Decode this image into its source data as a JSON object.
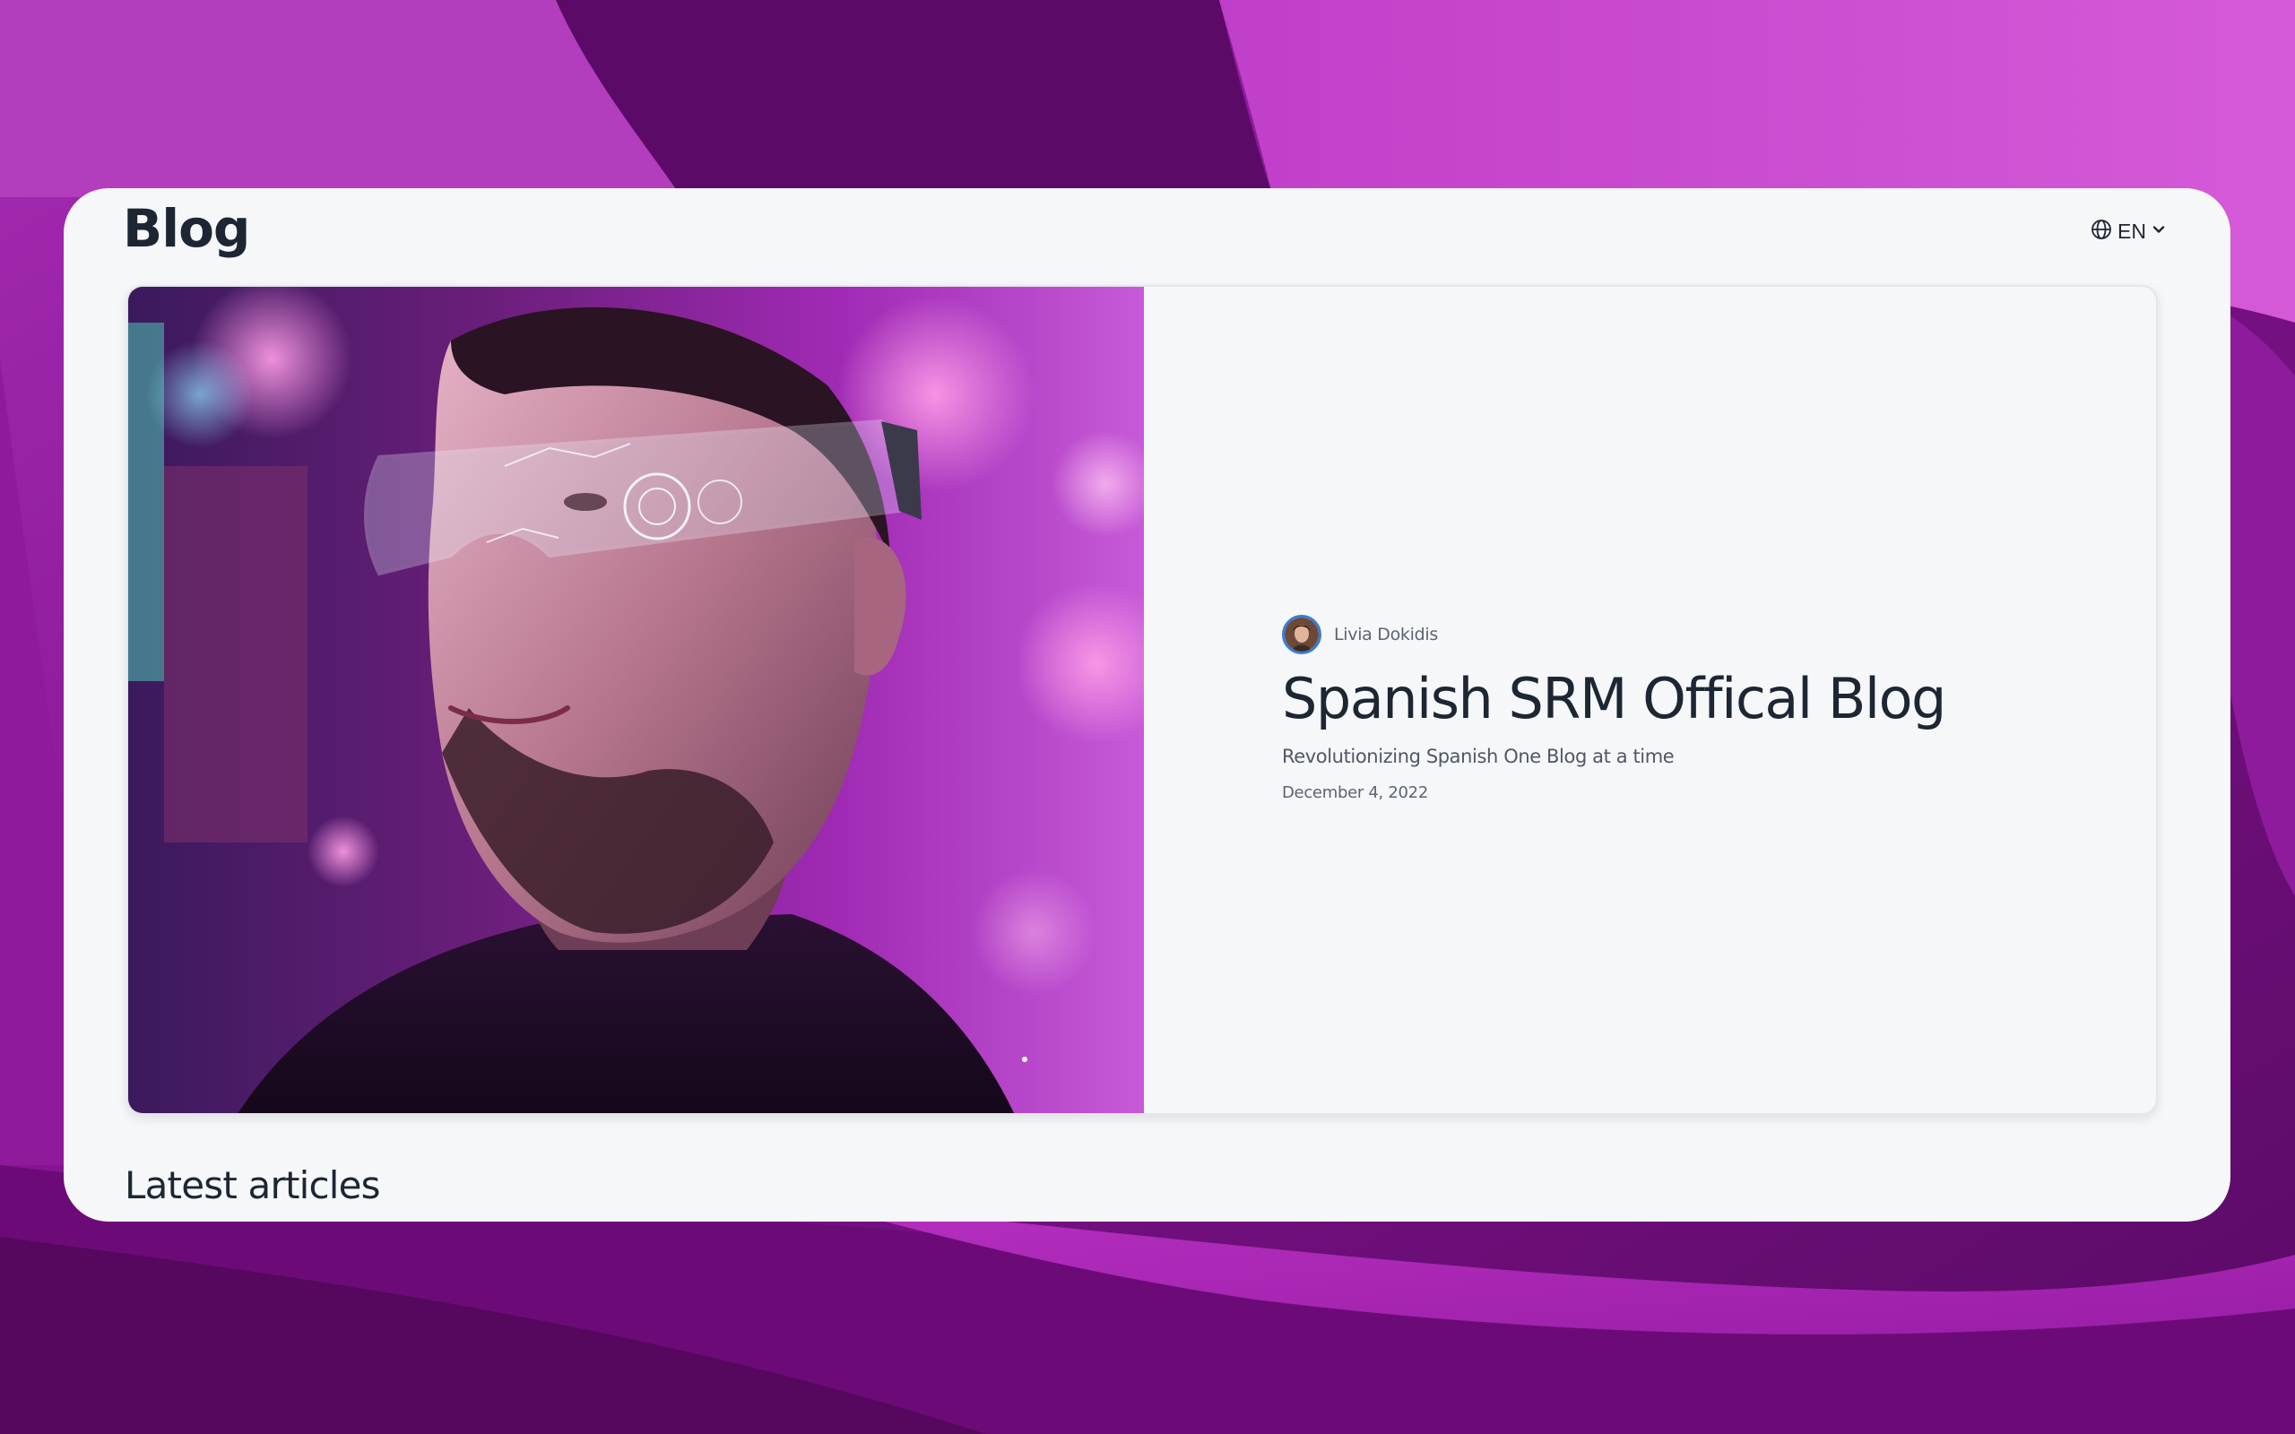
{
  "page": {
    "title": "Blog",
    "language": "EN"
  },
  "hero": {
    "author": "Livia Dokidis",
    "title": "Spanish SRM Offical Blog",
    "subtitle": "Revolutionizing Spanish One Blog at a time",
    "date": "December 4, 2022",
    "image_description": "man-wearing-futuristic-glasses-neon-purple"
  },
  "sections": {
    "latest_title": "Latest articles"
  },
  "icons": {
    "language": "globe-icon",
    "dropdown": "chevron-down-icon"
  },
  "colors": {
    "background": "#7a0f86",
    "window": "#f6f7f9",
    "text_primary": "#1d2633",
    "text_secondary": "#5b6472",
    "accent": "#3a7bd5"
  }
}
